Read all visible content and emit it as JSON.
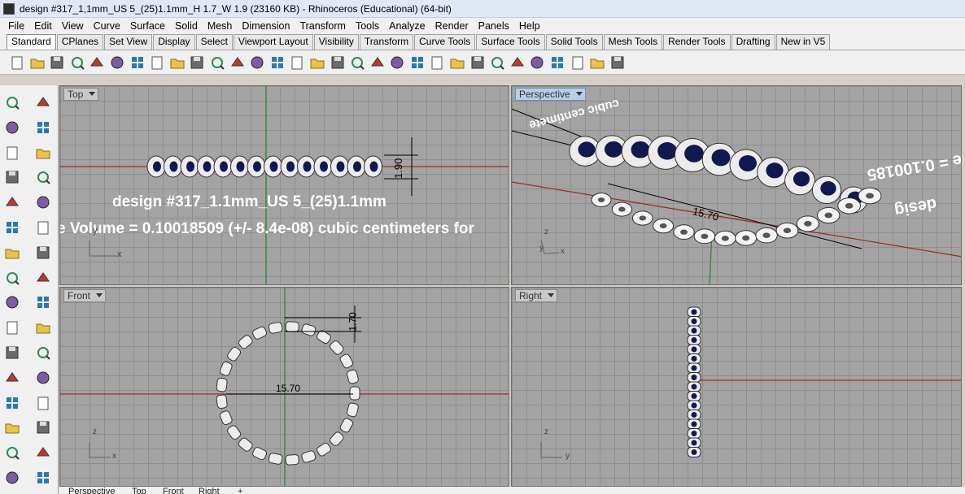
{
  "window": {
    "title": "design #317_1,1mm_US 5_(25)1.1mm_H 1.7_W 1.9 (23160 KB) - Rhinoceros (Educational) (64-bit)"
  },
  "menu": [
    "File",
    "Edit",
    "View",
    "Curve",
    "Surface",
    "Solid",
    "Mesh",
    "Dimension",
    "Transform",
    "Tools",
    "Analyze",
    "Render",
    "Panels",
    "Help"
  ],
  "toolbar_tabs": [
    "Standard",
    "CPlanes",
    "Set View",
    "Display",
    "Select",
    "Viewport Layout",
    "Visibility",
    "Transform",
    "Curve Tools",
    "Surface Tools",
    "Solid Tools",
    "Mesh Tools",
    "Render Tools",
    "Drafting",
    "New in V5"
  ],
  "active_tab": "Standard",
  "standard_tools": [
    "new-icon",
    "open-icon",
    "save-icon",
    "print-icon",
    "import-icon",
    "cut-icon",
    "copy-icon",
    "paste-icon",
    "undo-icon",
    "pan-icon",
    "rotate-view-icon",
    "zoom-icon",
    "zoom-window-icon",
    "zoom-extents-icon",
    "zoom-selected-icon",
    "undo-view-icon",
    "four-viewports-icon",
    "car-icon",
    "options-icon",
    "lock-view-icon",
    "light-icon",
    "lock-icon",
    "layer-icon",
    "color-icon",
    "render-shaded-icon",
    "render-ghost-icon",
    "render-icon",
    "material-icon",
    "point-select-icon",
    "grid-snap-icon",
    "help-icon"
  ],
  "side_tools": [
    "select-icon",
    "point-icon",
    "polyline-icon",
    "curve-points-icon",
    "circle-icon",
    "ellipse-icon",
    "arc-icon",
    "rectangle-icon",
    "polygon-icon",
    "fillet-icon",
    "surface-icon",
    "loft-icon",
    "box-icon",
    "sphere-icon",
    "extrude-icon",
    "cage-icon",
    "boolean-icon",
    "rebuild-icon",
    "explode-icon",
    "flip-icon",
    "trim-icon",
    "blend-icon",
    "text-icon",
    "dimension-icon",
    "array-icon",
    "group-icon",
    "block-icon",
    "hatch-icon",
    "mesh-icon",
    "analyze-icon",
    "curvature-icon",
    "check-icon"
  ],
  "viewports": {
    "top": {
      "label": "Top",
      "annotation_title": "design #317_1.1mm_US 5_(25)1.1mm",
      "annotation_volume": "e Volume = 0.10018509 (+/- 8.4e-08) cubic centimeters for",
      "dim_label": "1.90",
      "axis_x": "x",
      "axis_y": "y"
    },
    "perspective": {
      "label": "Perspective",
      "mirrored_volume": "olume = 0.100185",
      "mirrored_design": "desig",
      "mirrored_cubic": "cubic centimete",
      "dim_label": "15.70",
      "axis_x": "x",
      "axis_y": "y",
      "axis_z": "z"
    },
    "front": {
      "label": "Front",
      "dim_diameter": "15.70",
      "dim_height": "1.70",
      "axis_x": "x",
      "axis_z": "z"
    },
    "right": {
      "label": "Right",
      "axis_y": "y",
      "axis_z": "z"
    }
  },
  "bottom_tabs": [
    "Perspective",
    "Top",
    "Front",
    "Right",
    "+"
  ],
  "colors": {
    "viewport_bg": "#a3a3a3",
    "grid": "#8e8e8e",
    "x_axis": "#9a2f2a",
    "y_axis": "#2f8a2f",
    "gem": "#101850",
    "metal": "#ececec"
  }
}
